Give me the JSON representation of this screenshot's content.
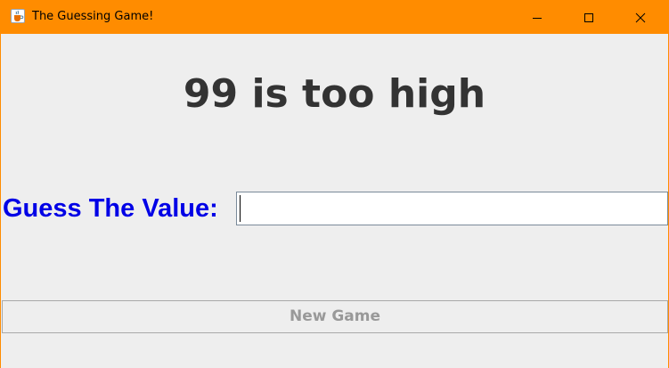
{
  "window": {
    "title": "The Guessing Game!",
    "title_bar_color": "#ff8c00",
    "icons": {
      "app": "java-cup-icon",
      "minimize": "minimize-icon",
      "maximize": "maximize-icon",
      "close": "close-icon"
    }
  },
  "game": {
    "message": "99 is too high",
    "message_color": "#333333",
    "guess_label": "Guess The Value:",
    "guess_label_color": "#0000e6",
    "guess_value": "",
    "new_game_label": "New Game",
    "new_game_enabled": false
  }
}
